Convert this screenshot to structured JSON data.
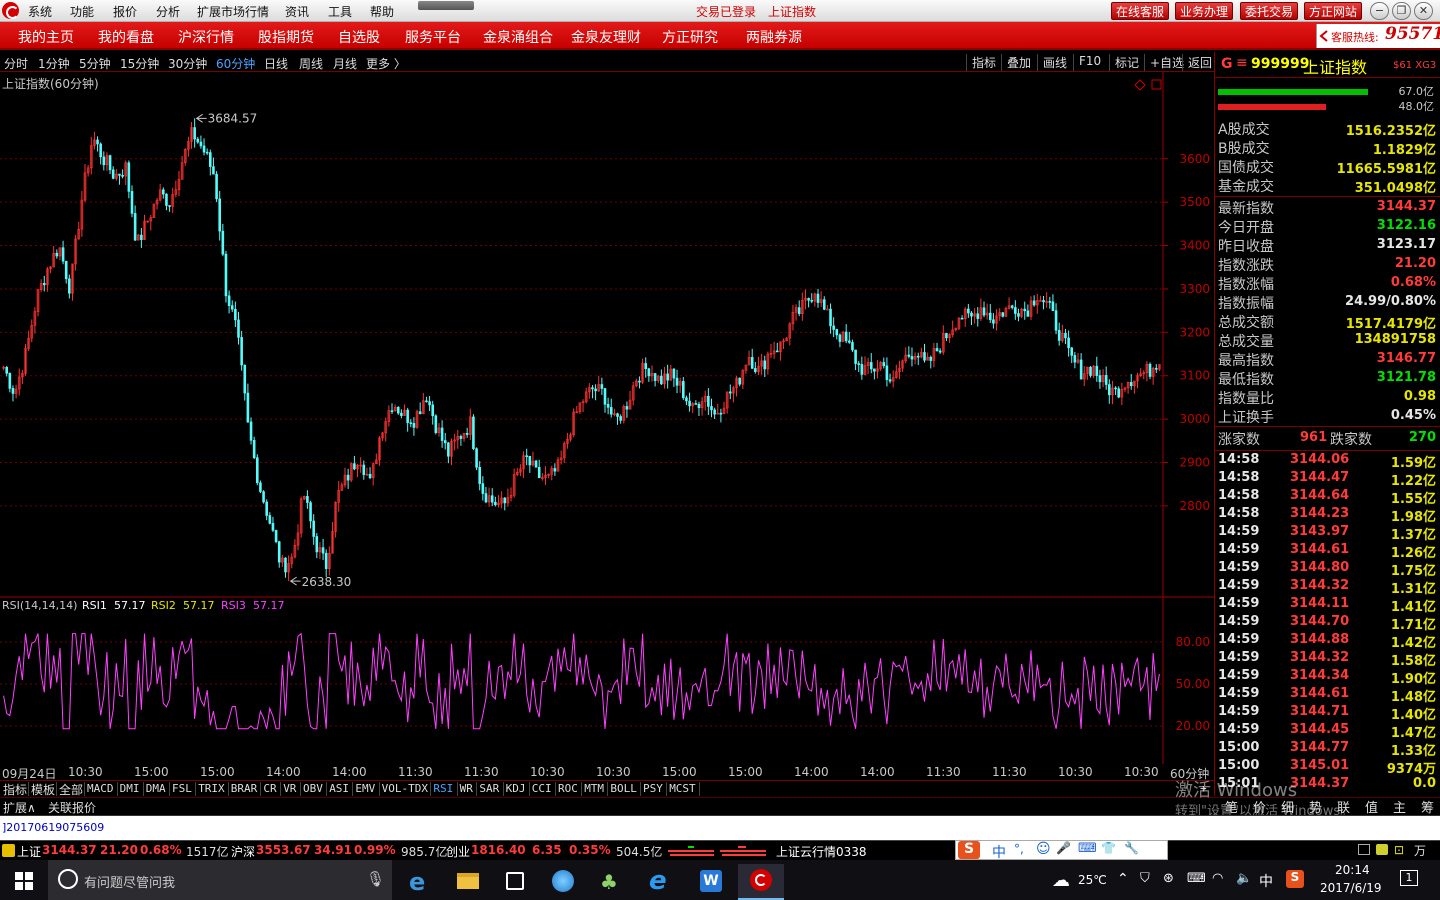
{
  "menubar": {
    "items": [
      "系统",
      "功能",
      "报价",
      "分析",
      "扩展市场行情",
      "资讯",
      "工具",
      "帮助"
    ],
    "status": [
      "交易已登录",
      "上证指数"
    ],
    "buttons": [
      "在线客服",
      "业务办理",
      "委托交易",
      "方正网站"
    ],
    "window_controls": [
      "−",
      "❐",
      "✕"
    ]
  },
  "navbar": {
    "items": [
      "我的主页",
      "我的看盘",
      "沪深行情",
      "股指期货",
      "自选股",
      "服务平台",
      "金泉涌组合",
      "金泉友理财",
      "方正研究",
      "两融券源"
    ],
    "hotline_label": "客服热线:",
    "hotline_number": "95571"
  },
  "periodbar": {
    "items": [
      "分时",
      "1分钟",
      "5分钟",
      "15分钟",
      "30分钟",
      "60分钟",
      "日线",
      "周线",
      "月线",
      "更多 〉"
    ],
    "active": "60分钟",
    "tools": [
      "指标",
      "叠加",
      "画线",
      "F10",
      "标记",
      "+自选",
      "返回"
    ]
  },
  "chart_data": [
    {
      "type": "candlestick",
      "title": "上证指数(60分钟)",
      "ylim": [
        2590,
        3800
      ],
      "yticks": [
        "3600",
        "3500",
        "3400",
        "3300",
        "3200",
        "3100",
        "3000",
        "2900",
        "2800"
      ],
      "annotations": [
        {
          "label": "3684.57",
          "kind": "high"
        },
        {
          "label": "2638.30",
          "kind": "low"
        }
      ],
      "close_path": [
        3120,
        3060,
        3150,
        3280,
        3350,
        3400,
        3300,
        3500,
        3650,
        3600,
        3560,
        3580,
        3400,
        3460,
        3520,
        3500,
        3590,
        3660,
        3620,
        3560,
        3300,
        3200,
        2980,
        2850,
        2760,
        2660,
        2680,
        2830,
        2720,
        2660,
        2820,
        2870,
        2920,
        2850,
        2980,
        3040,
        3010,
        3000,
        3060,
        2980,
        2920,
        2960,
        2990,
        2840,
        2810,
        2800,
        2860,
        2910,
        2870,
        2860,
        2890,
        2980,
        3040,
        3070,
        3060,
        2990,
        3030,
        3100,
        3120,
        3090,
        3100,
        3070,
        3020,
        3060,
        3010,
        3050,
        3080,
        3150,
        3110,
        3160,
        3170,
        3230,
        3260,
        3300,
        3240,
        3200,
        3170,
        3120,
        3110,
        3130,
        3080,
        3140,
        3160,
        3120,
        3160,
        3200,
        3240,
        3230,
        3260,
        3230,
        3250,
        3260,
        3250,
        3290,
        3260,
        3200,
        3140,
        3110,
        3120,
        3080,
        3060,
        3090,
        3100,
        3110,
        3140
      ]
    },
    {
      "type": "line",
      "title": "RSI(14,14,14)",
      "series": [
        {
          "name": "RSI1",
          "value": "57.17",
          "color": "#ffffff"
        },
        {
          "name": "RSI2",
          "value": "57.17",
          "color": "#e6e600"
        },
        {
          "name": "RSI3",
          "value": "57.17",
          "color": "#ff40ff"
        }
      ],
      "ylim": [
        0,
        100
      ],
      "yticks": [
        "80.00",
        "50.00",
        "20.00"
      ],
      "last_value": 57.17
    }
  ],
  "timeaxis": [
    "09月24日",
    "10:30",
    "15:00",
    "15:00",
    "14:00",
    "14:00",
    "11:30",
    "11:30",
    "10:30",
    "10:30",
    "15:00",
    "15:00",
    "14:00",
    "14:00",
    "11:30",
    "11:30",
    "10:30",
    "10:30",
    "60分钟"
  ],
  "indicator_tabs": {
    "items": [
      "指标",
      "模板",
      "全部",
      "MACD",
      "DMI",
      "DMA",
      "FSL",
      "TRIX",
      "BRAR",
      "CR",
      "VR",
      "OBV",
      "ASI",
      "EMV",
      "VOL-TDX",
      "RSI",
      "WR",
      "SAR",
      "KDJ",
      "CCI",
      "ROC",
      "MTM",
      "BOLL",
      "PSY",
      "MCST"
    ],
    "active": "RSI",
    "plus": "+"
  },
  "exprow": {
    "items": [
      "扩展∧",
      "关联报价"
    ]
  },
  "rightpanel": {
    "code": "999999",
    "name": "上证指数",
    "flag": "G",
    "tags": "$61 XG3",
    "bars": [
      {
        "pct": "67.0亿",
        "color": "#00c000"
      },
      {
        "pct": "48.0亿",
        "color": "#e02020"
      }
    ],
    "turnover": [
      {
        "label": "A股成交",
        "value": "1516.2352亿"
      },
      {
        "label": "B股成交",
        "value": "1.1829亿"
      },
      {
        "label": "国债成交",
        "value": "11665.5981亿"
      },
      {
        "label": "基金成交",
        "value": "351.0498亿"
      }
    ],
    "stats": [
      {
        "label": "最新指数",
        "value": "3144.37",
        "color": "#ff3b3b"
      },
      {
        "label": "今日开盘",
        "value": "3122.16",
        "color": "#00e000"
      },
      {
        "label": "昨日收盘",
        "value": "3123.17",
        "color": "#e6e6e6"
      },
      {
        "label": "指数涨跌",
        "value": "21.20",
        "color": "#ff3b3b"
      },
      {
        "label": "指数涨幅",
        "value": "0.68%",
        "color": "#ff3b3b"
      },
      {
        "label": "指数振幅",
        "value": "24.99/0.80%",
        "color": "#e6e6e6"
      },
      {
        "label": "总成交额",
        "value": "1517.4179亿",
        "color": "#e6e600"
      },
      {
        "label": "总成交量",
        "value": "134891758",
        "color": "#e6e600"
      },
      {
        "label": "最高指数",
        "value": "3146.77",
        "color": "#ff3b3b"
      },
      {
        "label": "最低指数",
        "value": "3121.78",
        "color": "#00e000"
      },
      {
        "label": "指数量比",
        "value": "0.98",
        "color": "#e6e600"
      },
      {
        "label": "上证换手",
        "value": "0.45%",
        "color": "#e6e6e6"
      }
    ],
    "updown": {
      "up_label": "涨家数",
      "up": "961",
      "down_label": "跌家数",
      "down": "270"
    },
    "ticks": [
      {
        "t": "14:58",
        "p": "3144.06",
        "v": "1.59亿"
      },
      {
        "t": "14:58",
        "p": "3144.47",
        "v": "1.22亿"
      },
      {
        "t": "14:58",
        "p": "3144.64",
        "v": "1.55亿"
      },
      {
        "t": "14:58",
        "p": "3144.23",
        "v": "1.98亿"
      },
      {
        "t": "14:59",
        "p": "3143.97",
        "v": "1.37亿"
      },
      {
        "t": "14:59",
        "p": "3144.61",
        "v": "1.26亿"
      },
      {
        "t": "14:59",
        "p": "3144.80",
        "v": "1.75亿"
      },
      {
        "t": "14:59",
        "p": "3144.32",
        "v": "1.31亿"
      },
      {
        "t": "14:59",
        "p": "3144.11",
        "v": "1.41亿"
      },
      {
        "t": "14:59",
        "p": "3144.70",
        "v": "1.71亿"
      },
      {
        "t": "14:59",
        "p": "3144.88",
        "v": "1.42亿"
      },
      {
        "t": "14:59",
        "p": "3144.32",
        "v": "1.58亿"
      },
      {
        "t": "14:59",
        "p": "3144.34",
        "v": "1.90亿"
      },
      {
        "t": "14:59",
        "p": "3144.61",
        "v": "1.48亿"
      },
      {
        "t": "14:59",
        "p": "3144.71",
        "v": "1.40亿"
      },
      {
        "t": "14:59",
        "p": "3144.45",
        "v": "1.47亿"
      },
      {
        "t": "15:00",
        "p": "3144.77",
        "v": "1.33亿"
      },
      {
        "t": "15:00",
        "p": "3145.01",
        "v": "9374万"
      },
      {
        "t": "15:01",
        "p": "3144.37",
        "v": "0.0"
      }
    ],
    "bottom_tabs": [
      "笔",
      "价",
      "细",
      "势",
      "联",
      "值",
      "主",
      "筹"
    ],
    "watermark": "激活 Windows",
    "watermark_sub": "转到\"设置\"以激活 Windows。"
  },
  "message": "]20170619075609",
  "statusbar": {
    "sh": {
      "name": "上证",
      "price": "3144.37",
      "chg": "21.20",
      "pct": "0.68%",
      "amt": "1517亿"
    },
    "hs": {
      "name": "沪深",
      "price": "3553.67",
      "chg": "34.91",
      "pct": "0.99%",
      "amt": "985.7亿"
    },
    "cy": {
      "name": "创业",
      "price": "1816.40",
      "chg": "6.35",
      "pct": "0.35%",
      "amt": "504.5亿"
    },
    "cloud": "上证云行情0338"
  },
  "ime": {
    "items": [
      "中",
      "°,",
      "☺",
      "🎤",
      "⌨",
      "👕",
      "🔧"
    ]
  },
  "taskbar": {
    "search_placeholder": "有问题尽管问我",
    "temp": "25℃",
    "ime_lang": "中",
    "time": "20:14",
    "date": "2017/6/19",
    "notif": "1"
  }
}
